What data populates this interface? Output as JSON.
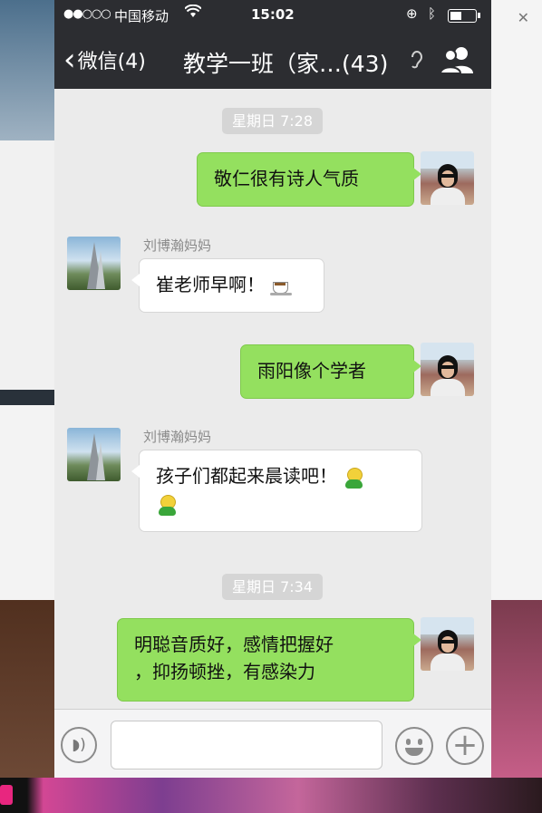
{
  "status_bar": {
    "signal": "●●○○○",
    "carrier": "中国移动",
    "time": "15:02"
  },
  "nav": {
    "back_label": "微信(4)",
    "title": "教学一班（家…(43)"
  },
  "messages": [
    {
      "type": "timestamp",
      "text": "星期日 7:28"
    },
    {
      "type": "sent",
      "text": "敬仁很有诗人气质"
    },
    {
      "type": "received",
      "sender": "刘博瀚妈妈",
      "text": "崔老师早啊！",
      "emoji": "coffee"
    },
    {
      "type": "sent",
      "text": "雨阳像个学者"
    },
    {
      "type": "received",
      "sender": "刘博瀚妈妈",
      "text": "孩子们都起来晨读吧！",
      "emoji": "sprout"
    },
    {
      "type": "timestamp",
      "text": "星期日 7:34"
    },
    {
      "type": "sent",
      "text_line1": "明聪音质好，感情把握好",
      "text_line2": "，抑扬顿挫，有感染力"
    }
  ],
  "input_bar": {
    "value": ""
  },
  "icons": {
    "voice": "voice-icon",
    "emoji": "emoji-icon",
    "plus": "plus-icon",
    "ear": "earpiece-icon",
    "group": "group-members-icon"
  },
  "colors": {
    "nav_bg": "#2c2d31",
    "sent_bubble": "#94e05f",
    "received_bubble": "#ffffff",
    "chat_bg": "#ebebeb"
  }
}
